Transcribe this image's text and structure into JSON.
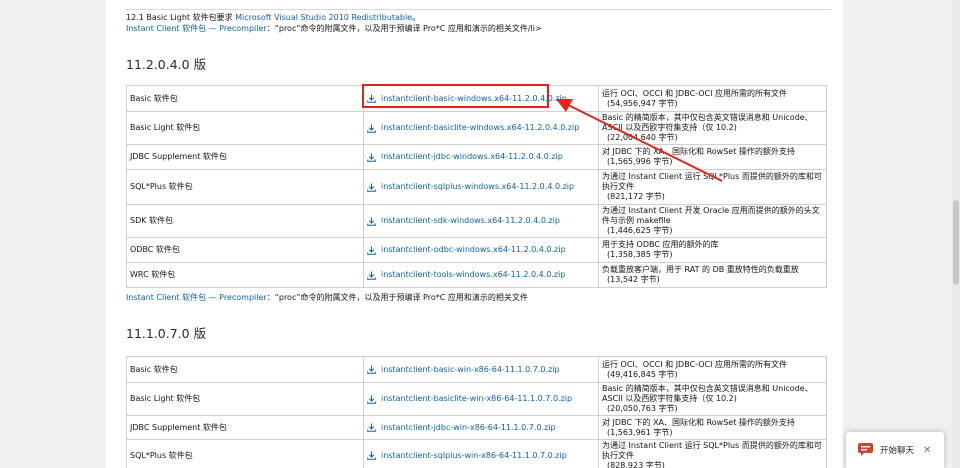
{
  "top_notes": {
    "line1_text": "12.1 Basic Light 软件包要求",
    "line1_link": "Microsoft Visual Studio 2010 Redistributable",
    "line1_end": "。",
    "line2_link": "Instant Client 软件包 — Precompiler",
    "line2_text": "：“proc”命令的附属文件，以及用于预编译 Pro*C 应用和演示的相关文件/li>"
  },
  "section1": {
    "title": "11.2.0.4.0 版",
    "rows": [
      {
        "package": "Basic 软件包",
        "file": "instantclient-basic-windows.x64-11.2.0.4.0.zip",
        "desc": "运行 OCI、OCCI 和 JDBC-OCI 应用所需的所有文件",
        "size": "(54,956,947 字节)"
      },
      {
        "package": "Basic Light 软件包",
        "file": "instantclient-basiclite-windows.x64-11.2.0.4.0.zip",
        "desc": "Basic 的精简版本，其中仅包含英文错误消息和 Unicode、ASCII 以及西欧字符集支持（仅 10.2)",
        "size": "(22,004,640 字节)"
      },
      {
        "package": "JDBC Supplement 软件包",
        "file": "instantclient-jdbc-windows.x64-11.2.0.4.0.zip",
        "desc": "对 JDBC 下的 XA、国际化和 RowSet 操作的额外支持",
        "size": "(1,565,996 字节)"
      },
      {
        "package": "SQL*Plus 软件包",
        "file": "instantclient-sqlplus-windows.x64-11.2.0.4.0.zip",
        "desc": "为通过 Instant Client 运行 SQL*Plus 而提供的额外的库和可执行文件",
        "size": "(821,172 字节)"
      },
      {
        "package": "SDK 软件包",
        "file": "instantclient-sdk-windows.x64-11.2.0.4.0.zip",
        "desc": "为通过 Instant Client 开发 Oracle 应用而提供的额外的头文件与示例 makefile",
        "size": "(1,446,625 字节)"
      },
      {
        "package": "ODBC 软件包",
        "file": "instantclient-odbc-windows.x64-11.2.0.4.0.zip",
        "desc": "用于支持 ODBC 应用的额外的库",
        "size": "(1,358,385 字节)"
      },
      {
        "package": "WRC 软件包",
        "file": "instantclient-tools-windows.x64-11.2.0.4.0.zip",
        "desc": "负载重放客户端，用于 RAT 的 DB 重放特性的负载重放",
        "size": "(13,542 字节)"
      }
    ],
    "note_link": "Instant Client 软件包 — Precompiler",
    "note_text": "：“proc”命令的附属文件，以及用于预编译 Pro*C 应用和演示的相关文件"
  },
  "section2": {
    "title": "11.1.0.7.0 版",
    "rows": [
      {
        "package": "Basic 软件包",
        "file": "instantclient-basic-win-x86-64-11.1.0.7.0.zip",
        "desc": "运行 OCI、OCCI 和 JDBC-OCI 应用所需的所有文件",
        "size": "(49,416,845 字节)"
      },
      {
        "package": "Basic Light 软件包",
        "file": "instantclient-basiclite-win-x86-64-11.1.0.7.0.zip",
        "desc": "Basic 的精简版本，其中仅包含英文错误消息和 Unicode、ASCII 以及西欧字符集支持（仅 10.2)",
        "size": "(20,050,763 字节)"
      },
      {
        "package": "JDBC Supplement 软件包",
        "file": "instantclient-jdbc-win-x86-64-11.1.0.7.0.zip",
        "desc": "对 JDBC 下的 XA、国际化和 RowSet 操作的额外支持",
        "size": "(1,563,961 字节)"
      },
      {
        "package": "SQL*Plus 软件包",
        "file": "instantclient-sqlplus-win-x86-64-11.1.0.7.0.zip",
        "desc": "为通过 Instant Client 运行 SQL*Plus 而提供的额外的库和可执行文件",
        "size": "(828,923 字节)"
      }
    ]
  },
  "chat_widget": {
    "label": "开始聊天",
    "close_glyph": "✕",
    "icon": "chat-bubble-icon",
    "accent": "#c74634"
  },
  "colors": {
    "link": "#0f62a6",
    "highlight": "#e8221b"
  }
}
